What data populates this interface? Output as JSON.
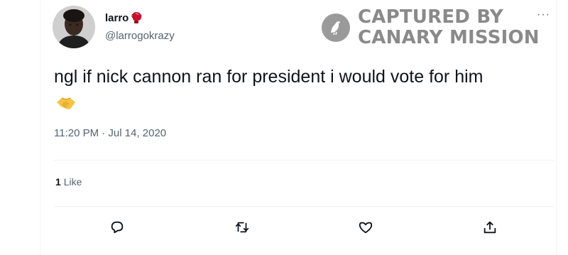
{
  "tweet": {
    "display_name": "larro",
    "handle": "@larrogokrazy",
    "name_emoji": "boxing-glove-icon",
    "text": "ngl if nick cannon ran for president i would vote for him",
    "body_emoji": "handshake-icon",
    "timestamp": "11:20 PM · Jul 14, 2020",
    "likes_count": "1",
    "likes_label": "Like"
  },
  "watermark": {
    "line1": "CAPTURED BY",
    "line2": "CANARY MISSION",
    "icon": "canary-bird-icon"
  },
  "actions": [
    {
      "name": "reply",
      "icon": "reply-icon"
    },
    {
      "name": "retweet",
      "icon": "retweet-icon"
    },
    {
      "name": "like",
      "icon": "heart-icon"
    },
    {
      "name": "share",
      "icon": "share-icon"
    }
  ],
  "colors": {
    "text_primary": "#0f1419",
    "text_secondary": "#536471",
    "watermark": "#8a8a8a",
    "emoji_glove": "#c8102e",
    "emoji_handshake": "#f6c343"
  }
}
